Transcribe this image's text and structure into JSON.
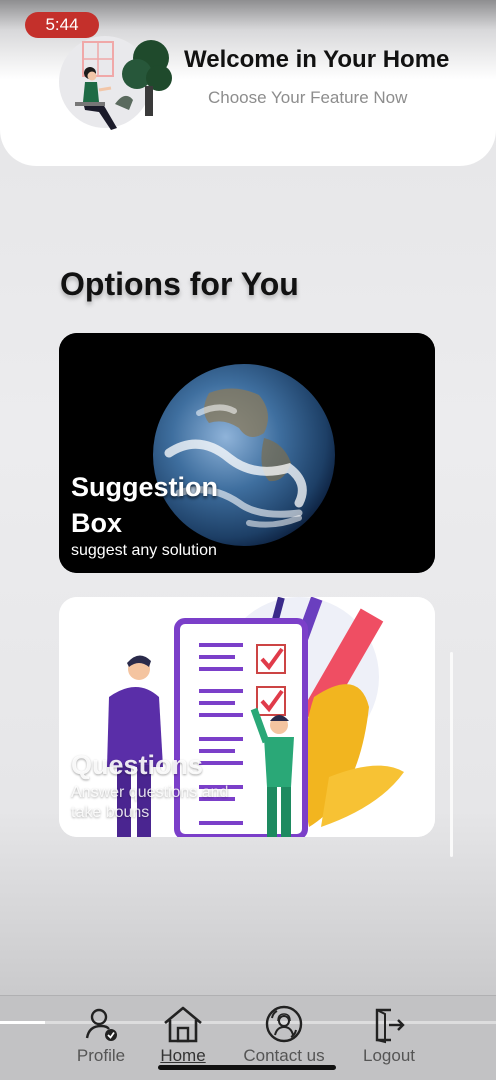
{
  "status_bar": {
    "time": "5:44"
  },
  "header": {
    "title": "Welcome in Your Home",
    "subtitle": "Choose Your Feature Now",
    "illustration_icon": "person-sitting-illustration"
  },
  "section": {
    "title": "Options for You"
  },
  "cards": [
    {
      "title": "Suggestion Box",
      "description": "suggest any solution",
      "image": "earth-globe"
    },
    {
      "title": "Questions",
      "description": "Answer questions and take bouns",
      "image": "checklist-illustration"
    }
  ],
  "bottom_nav": {
    "items": [
      {
        "label": "Profile",
        "icon": "user-check-icon"
      },
      {
        "label": "Home",
        "icon": "home-icon",
        "active": true
      },
      {
        "label": "Contact us",
        "icon": "support-agent-icon"
      },
      {
        "label": "Logout",
        "icon": "logout-icon"
      }
    ],
    "progress": 0.09
  },
  "colors": {
    "status_pill": "#c4302b",
    "accent_purple": "#7b3fc9",
    "check_red": "#e03b4a"
  }
}
